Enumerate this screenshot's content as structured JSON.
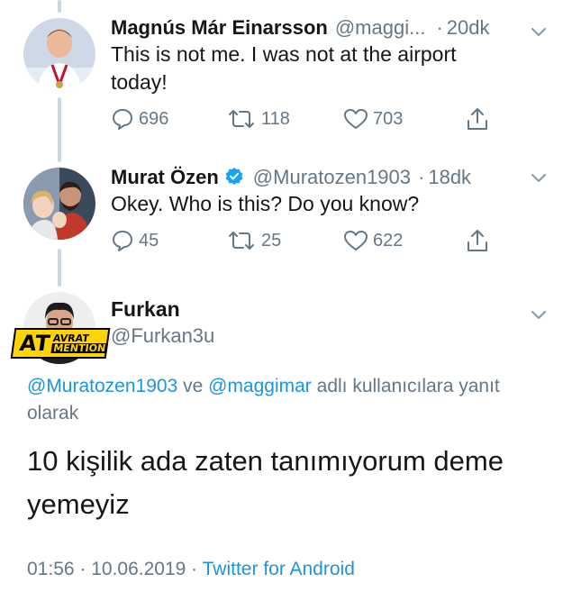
{
  "tweets": [
    {
      "display_name": "Magnús Már Einarsson",
      "handle": "@maggi...",
      "separator": "·",
      "time": "20dk",
      "text": "This is not me. I was not at the airport today!",
      "reply_count": "696",
      "retweet_count": "118",
      "like_count": "703"
    },
    {
      "display_name": "Murat Özen",
      "handle": "@Muratozen1903",
      "separator": "·",
      "time": "18dk",
      "verified": true,
      "text": "Okey. Who is this? Do you know?",
      "reply_count": "45",
      "retweet_count": "25",
      "like_count": "622"
    }
  ],
  "main_tweet": {
    "display_name": "Furkan",
    "handle": "@Furkan3u",
    "avatar_badge": {
      "line1": "AT",
      "line2": "AVRAT",
      "line3": "MENTION"
    },
    "reply_to_mention_1": "@Muratozen1903",
    "reply_to_connector": " ve ",
    "reply_to_mention_2": "@maggimar",
    "reply_to_suffix": " adlı kullanıcılara yanıt olarak",
    "text": "10 kişilik ada zaten tanımıyorum deme yemeyiz",
    "time": "01:56",
    "separator_1": " · ",
    "date": "10.06.2019",
    "separator_2": " · ",
    "source": "Twitter for Android"
  },
  "colors": {
    "link": "#1b95e0",
    "secondary": "#657786",
    "primary_text": "#14171a",
    "thread_line": "#ccd6dd",
    "verified": "#1da1f2"
  }
}
